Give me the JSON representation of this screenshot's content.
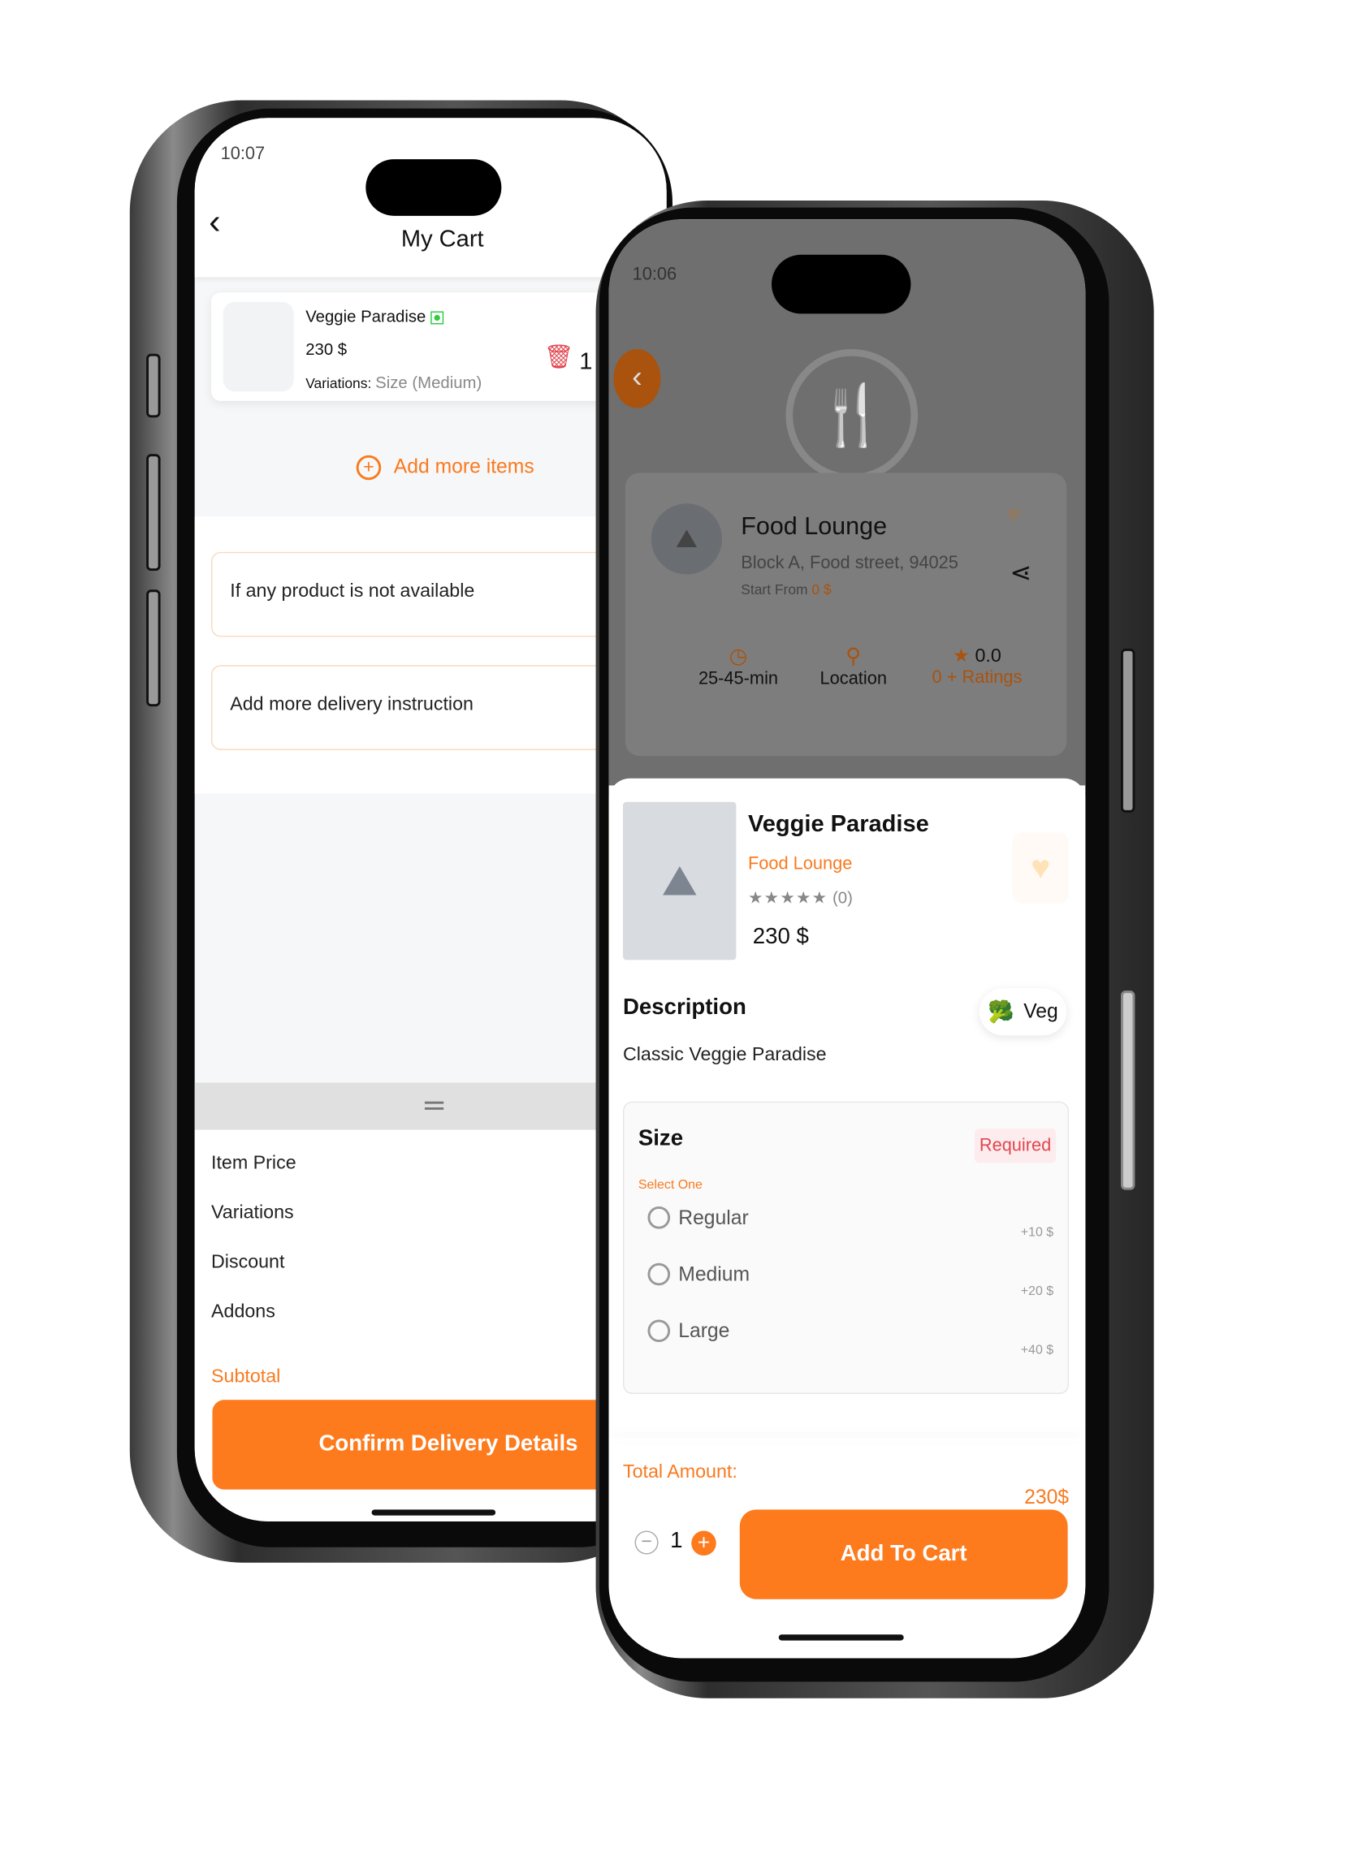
{
  "cart_screen": {
    "status": {
      "time": "10:07"
    },
    "title": "My Cart",
    "item": {
      "name": "Veggie Paradise",
      "price": "230 $",
      "variations_label": "Variations:",
      "variations_value": "Size (Medium)",
      "quantity": "1"
    },
    "add_more": "Add more items",
    "not_available": "If any product is not available",
    "delivery_instruction": "Add more delivery instruction",
    "summary": {
      "item_price": "Item Price",
      "variations": "Variations",
      "discount": "Discount",
      "addons": "Addons",
      "subtotal": "Subtotal"
    },
    "confirm_button": "Confirm Delivery Details"
  },
  "product_screen": {
    "status": {
      "time": "10:06"
    },
    "restaurant": {
      "name": "Food Lounge",
      "address": "Block A, Food street, 94025",
      "start_from_label": "Start From",
      "start_from_value": "0 $"
    },
    "info": {
      "time": "25-45-min",
      "location": "Location",
      "rating": "0.0",
      "ratings_count": "0 + Ratings"
    },
    "product": {
      "name": "Veggie Paradise",
      "restaurant": "Food Lounge",
      "review_count": "(0)",
      "price": "230 $",
      "rating": 0
    },
    "description_title": "Description",
    "description": "Classic Veggie Paradise",
    "veg_badge": "Veg",
    "size": {
      "title": "Size",
      "required": "Required",
      "select_one": "Select One",
      "options": [
        {
          "label": "Regular",
          "price": "+10 $"
        },
        {
          "label": "Medium",
          "price": "+20 $"
        },
        {
          "label": "Large",
          "price": "+40 $"
        }
      ]
    },
    "total_label": "Total Amount:",
    "total_value": "230$",
    "quantity": "1",
    "add_to_cart": "Add To Cart"
  },
  "colors": {
    "accent": "#fd7a1d",
    "required": "#e0464f",
    "veg": "#2ecc40"
  }
}
